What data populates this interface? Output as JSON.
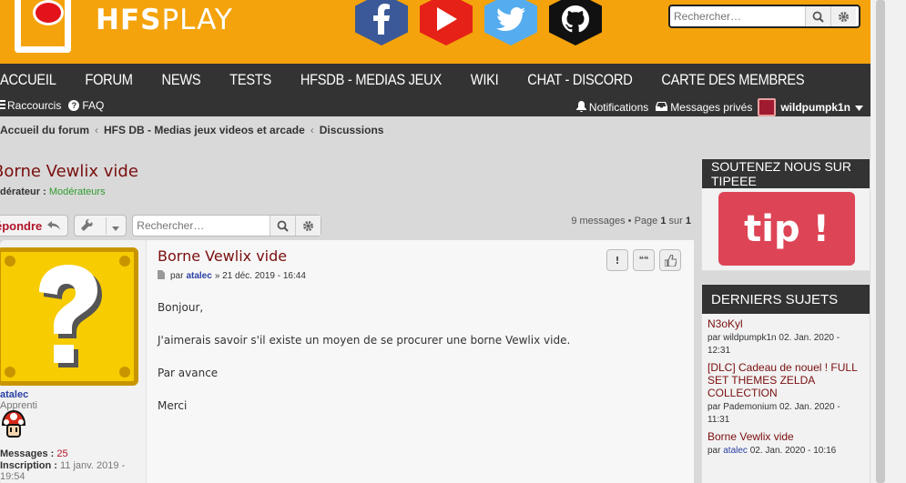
{
  "brand": {
    "bold": "HFS",
    "light": "PLAY"
  },
  "social": [
    {
      "name": "facebook-icon",
      "color": "#3b5998"
    },
    {
      "name": "youtube-icon",
      "color": "#e62117"
    },
    {
      "name": "twitter-icon",
      "color": "#55acee"
    },
    {
      "name": "github-icon",
      "color": "#111111"
    }
  ],
  "header_search": {
    "placeholder": "Rechercher…"
  },
  "nav": {
    "items": [
      "ACCUEIL",
      "FORUM",
      "NEWS",
      "TESTS",
      "HFSDB - MEDIAS JEUX",
      "WIKI",
      "CHAT - DISCORD",
      "CARTE DES MEMBRES"
    ],
    "quicklinks": "Raccourcis",
    "faq": "FAQ",
    "notifications": "Notifications",
    "messages": "Messages privés",
    "user": "wildpumpk1n"
  },
  "breadcrumb": [
    "Accueil du forum",
    "HFS DB - Medias jeux videos et arcade",
    "Discussions"
  ],
  "topic": {
    "title": "Borne Vewlix vide",
    "moderator_label": "dérateur :",
    "moderator_value": "Modérateurs",
    "reply_label": "épondre",
    "search_placeholder": "Rechercher…",
    "pagination": {
      "count": "9 messages • Page",
      "page": "1",
      "of": "sur",
      "total": "1"
    }
  },
  "post": {
    "title": "Borne Vewlix vide",
    "by": "par",
    "author": "atalec",
    "date": "» 21 déc. 2019 - 16:44",
    "lines": [
      "Bonjour,",
      "J'aimerais savoir s'il existe un moyen de se procurer une borne Vewlix vide.",
      "Par avance",
      "Merci"
    ],
    "buttons": {
      "report": "!",
      "quote": "❝❝",
      "like": "👍"
    }
  },
  "author_profile": {
    "name": "atalec",
    "rank": "Apprenti",
    "messages_label": "Messages :",
    "messages_value": "25",
    "joined_label": "Inscription :",
    "joined_value": "11 janv. 2019 -",
    "joined_time": "19:54"
  },
  "sidebar": {
    "tipeee_title": "SOUTENEZ NOUS SUR TIPEEE",
    "tip_button": "tip !",
    "recent_title": "DERNIERS SUJETS",
    "topics": [
      {
        "title": "N3oKyl",
        "by": "par",
        "author": "wildpumpk1n",
        "date": "02. Jan. 2020 -",
        "time": "12:31"
      },
      {
        "title": "[DLC] Cadeau de nouel ! FULL SET THEMES ZELDA COLLECTION",
        "by": "par",
        "author": "Pademonium",
        "date": "02. Jan. 2020 -",
        "time": "11:31"
      },
      {
        "title": "Borne Vewlix vide",
        "by": "par",
        "author": "atalec",
        "date": "02. Jan. 2020 - 10:16",
        "time": ""
      }
    ]
  },
  "colors": {
    "brand_orange": "#f4a30c",
    "nav_dark": "#333333",
    "title_red": "#7a0e0e",
    "link_blue": "#2a3fa4",
    "mod_green": "#2e9b2e"
  }
}
